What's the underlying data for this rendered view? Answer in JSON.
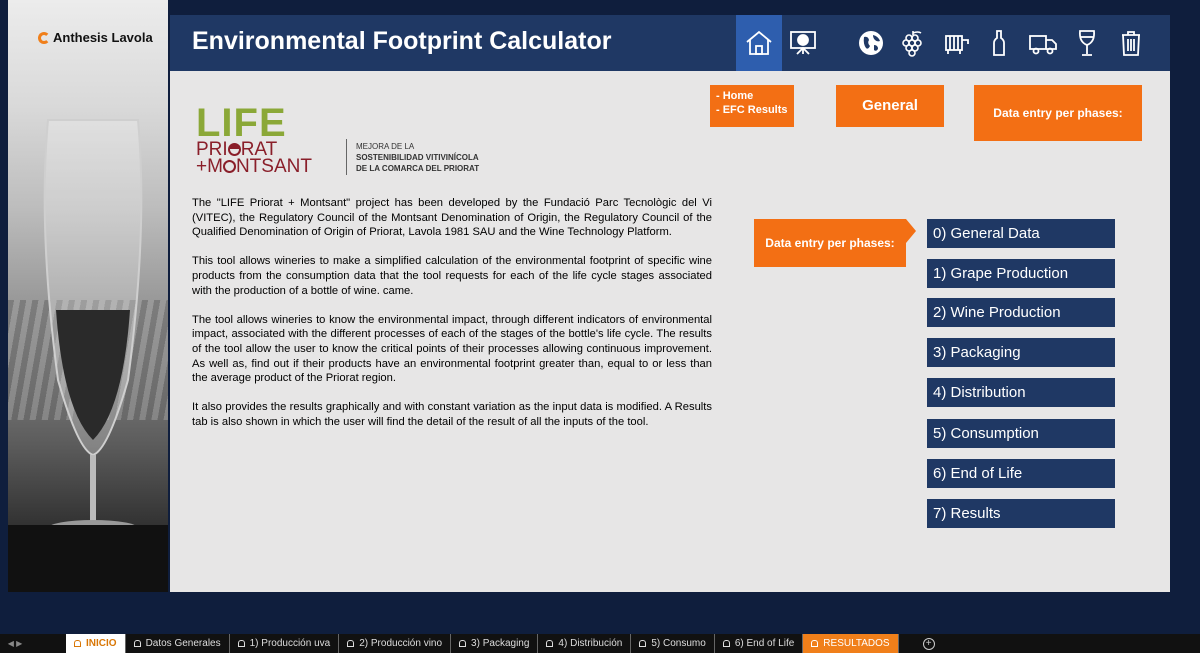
{
  "logo": {
    "text": "Anthesis Lavola",
    "accent_color": "#f07f1a"
  },
  "header": {
    "title": "Environmental Footprint Calculator",
    "icons": [
      "home-icon",
      "presentation-chart-icon",
      "globe-icon",
      "grape-icon",
      "press-icon",
      "bottle-icon",
      "truck-icon",
      "wine-glass-icon",
      "trash-bin-icon"
    ],
    "active_icon": "home-icon",
    "color": "#1f3864"
  },
  "callouts": {
    "home_line1": "- Home",
    "home_line2": "- EFC Results",
    "general": "General",
    "data_entry": "Data entry per phases:",
    "data_entry_side": "Data entry per phases:",
    "color": "#f36f14"
  },
  "project_logo": {
    "life": "LIFE",
    "priorat": "PRI",
    "priorat_rest": "RAT",
    "montsant": "+M",
    "montsant_rest": "NTSANT",
    "tagline_1": "MEJORA DE LA",
    "tagline_2": "SOSTENIBILIDAD VITIVINÍCOLA",
    "tagline_3": "DE LA COMARCA DEL PRIORAT"
  },
  "description": [
    "The \"LIFE Priorat + Montsant\" project has been developed by the Fundació Parc Tecnològic del Vi (VITEC), the Regulatory Council of the Montsant Denomination of Origin, the Regulatory Council of the Qualified Denomination of Origin of Priorat, Lavola 1981 SAU and the Wine Technology Platform.",
    "This tool allows wineries to make a simplified calculation of the environmental footprint of specific wine products from the consumption data that the tool requests for each of the life cycle stages associated with the production of a bottle of wine. came.",
    "The tool allows wineries to know the environmental impact, through different indicators of environmental impact, associated with the different processes of each of the stages of the bottle's life cycle. The results of the tool allow the user to know the critical points of their processes allowing continuous improvement. As well as, find out if their products have an environmental footprint greater than, equal to or less than the average product of the Priorat region.",
    "It also provides the results graphically and with constant variation as the input data is modified. A Results tab is also shown in which the user will find the detail of the result of all the inputs of the tool."
  ],
  "phases": [
    "0) General Data",
    "1) Grape Production",
    "2) Wine Production",
    "3) Packaging",
    "4) Distribution",
    "5) Consumption",
    "6) End of Life",
    "7) Results"
  ],
  "sheet_tabs": [
    {
      "label": "INICIO",
      "state": "active"
    },
    {
      "label": "Datos Generales",
      "state": "normal"
    },
    {
      "label": "1) Producción uva",
      "state": "normal"
    },
    {
      "label": "2) Producción vino",
      "state": "normal"
    },
    {
      "label": "3) Packaging",
      "state": "normal"
    },
    {
      "label": "4) Distribución",
      "state": "normal"
    },
    {
      "label": "5) Consumo",
      "state": "normal"
    },
    {
      "label": "6) End of Life",
      "state": "normal"
    },
    {
      "label": "RESULTADOS",
      "state": "results"
    }
  ]
}
